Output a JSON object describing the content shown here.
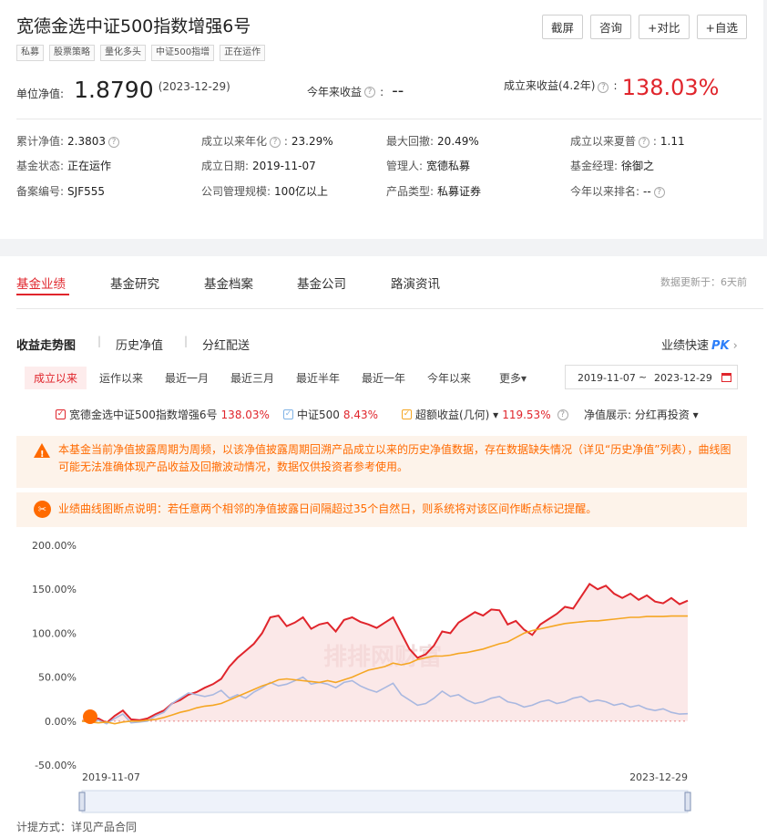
{
  "fund": {
    "name": "宽德金选中证500指数增强6号",
    "tags": [
      "私募",
      "股票策略",
      "量化多头",
      "中证500指增",
      "正在运作"
    ]
  },
  "actions": [
    "截屏",
    "咨询",
    "+对比",
    "+自选"
  ],
  "nav": {
    "label": "单位净值:",
    "value": "1.8790",
    "date": "(2023-12-29)"
  },
  "ytd": {
    "label": "今年来收益",
    "value": "--"
  },
  "since": {
    "label": "成立来收益(4.2年)",
    "value": "138.03%"
  },
  "info": [
    [
      {
        "k": "累计净值:",
        "v": "2.3803",
        "q": true
      },
      {
        "k": "成立以来年化",
        "v": "23.29%",
        "q": true,
        "colon": true
      },
      {
        "k": "最大回撤:",
        "v": "20.49%"
      },
      {
        "k": "成立以来夏普",
        "v": "1.11",
        "q": true,
        "colon": true
      }
    ],
    [
      {
        "k": "基金状态:",
        "v": "正在运作"
      },
      {
        "k": "成立日期:",
        "v": "2019-11-07"
      },
      {
        "k": "管理人:",
        "v": "宽德私募",
        "link": true
      },
      {
        "k": "基金经理:",
        "v": "徐御之",
        "link": true
      }
    ],
    [
      {
        "k": "备案编号:",
        "v": "SJF555"
      },
      {
        "k": "公司管理规模:",
        "v": "100亿以上"
      },
      {
        "k": "产品类型:",
        "v": "私募证券"
      },
      {
        "k": "今年以来排名:",
        "v": "--",
        "q": true
      }
    ]
  ],
  "tabs": [
    "基金业绩",
    "基金研究",
    "基金档案",
    "基金公司",
    "路演资讯"
  ],
  "update": "数据更新于：6天前",
  "subtabs": [
    "收益走势图",
    "历史净值",
    "分红配送"
  ],
  "quick": "业绩快速",
  "quick_pk": "PK",
  "ranges": [
    "成立以来",
    "运作以来",
    "最近一月",
    "最近三月",
    "最近半年",
    "最近一年",
    "今年以来",
    "更多▾"
  ],
  "date_from": "2019-11-07",
  "date_tilde": "~",
  "date_to": "2023-12-29",
  "legend": [
    {
      "name": "宽德金选中证500指数增强6号",
      "value": "138.03%",
      "color": "#e0252c"
    },
    {
      "name": "中证500",
      "value": "8.43%",
      "color": "#7fb2e5"
    },
    {
      "name": "超额收益(几何) ▾",
      "value": "119.53%",
      "color": "#f5a623"
    }
  ],
  "nav_show": "净值展示: 分红再投资 ▾",
  "notice1": "本基金当前净值披露周期为周频，以该净值披露周期回溯产品成立以来的历史净值数据，存在数据缺失情况（详见“历史净值”列表），曲线图可能无法准确体现产品收益及回撤波动情况，数据仅供投资者参考使用。",
  "notice2": "业绩曲线图断点说明：若任意两个相邻的净值披露日间隔超过35个自然日，则系统将对该区间作断点标记提醒。",
  "watermark": "排排网财富",
  "fee": "计提方式：详见产品合同",
  "chart_data": {
    "type": "line",
    "yticks": [
      "200.00%",
      "150.00%",
      "100.00%",
      "50.00%",
      "0.00%",
      "-50.00%"
    ],
    "ylim": [
      -50,
      200
    ],
    "xticks": [
      "2019-11-07",
      "2023-12-29"
    ],
    "series": [
      {
        "name": "宽德金选中证500指数增强6号",
        "color": "#e0252c",
        "values": [
          0,
          1,
          3,
          -2,
          6,
          12,
          2,
          1,
          3,
          8,
          12,
          20,
          24,
          30,
          33,
          38,
          42,
          48,
          62,
          72,
          80,
          88,
          100,
          118,
          120,
          108,
          112,
          118,
          105,
          110,
          112,
          102,
          115,
          118,
          113,
          110,
          106,
          112,
          118,
          100,
          82,
          72,
          76,
          86,
          102,
          100,
          112,
          118,
          124,
          120,
          127,
          126,
          110,
          114,
          104,
          98,
          110,
          116,
          122,
          130,
          128,
          142,
          156,
          150,
          154,
          145,
          140,
          145,
          138,
          143,
          136,
          134,
          140,
          133,
          137
        ]
      },
      {
        "name": "中证500",
        "color": "#a9b8e0",
        "values": [
          0,
          -1,
          1,
          -3,
          3,
          8,
          -2,
          -1,
          0,
          6,
          10,
          20,
          26,
          32,
          30,
          28,
          30,
          35,
          26,
          30,
          26,
          33,
          38,
          44,
          40,
          42,
          46,
          50,
          42,
          44,
          42,
          38,
          44,
          46,
          40,
          36,
          33,
          38,
          43,
          30,
          24,
          18,
          20,
          26,
          34,
          28,
          30,
          24,
          20,
          22,
          26,
          28,
          22,
          20,
          16,
          18,
          22,
          24,
          20,
          22,
          26,
          28,
          22,
          24,
          22,
          18,
          20,
          16,
          18,
          14,
          12,
          14,
          10,
          8,
          8.43
        ]
      },
      {
        "name": "超额收益(几何)",
        "color": "#f5a623",
        "values": [
          0,
          -1,
          -2,
          -1,
          -3,
          -1,
          0,
          0,
          1,
          2,
          4,
          7,
          10,
          12,
          15,
          17,
          18,
          20,
          24,
          28,
          32,
          36,
          40,
          43,
          47,
          48,
          47,
          46,
          45,
          44,
          46,
          44,
          47,
          50,
          54,
          58,
          60,
          62,
          66,
          64,
          66,
          70,
          72,
          74,
          74,
          75,
          77,
          78,
          80,
          82,
          85,
          88,
          90,
          95,
          100,
          103,
          105,
          107,
          109,
          111,
          112,
          113,
          114,
          114,
          115,
          116,
          117,
          118,
          118,
          119,
          119,
          119,
          119.5,
          119.53,
          119.53
        ]
      }
    ]
  }
}
